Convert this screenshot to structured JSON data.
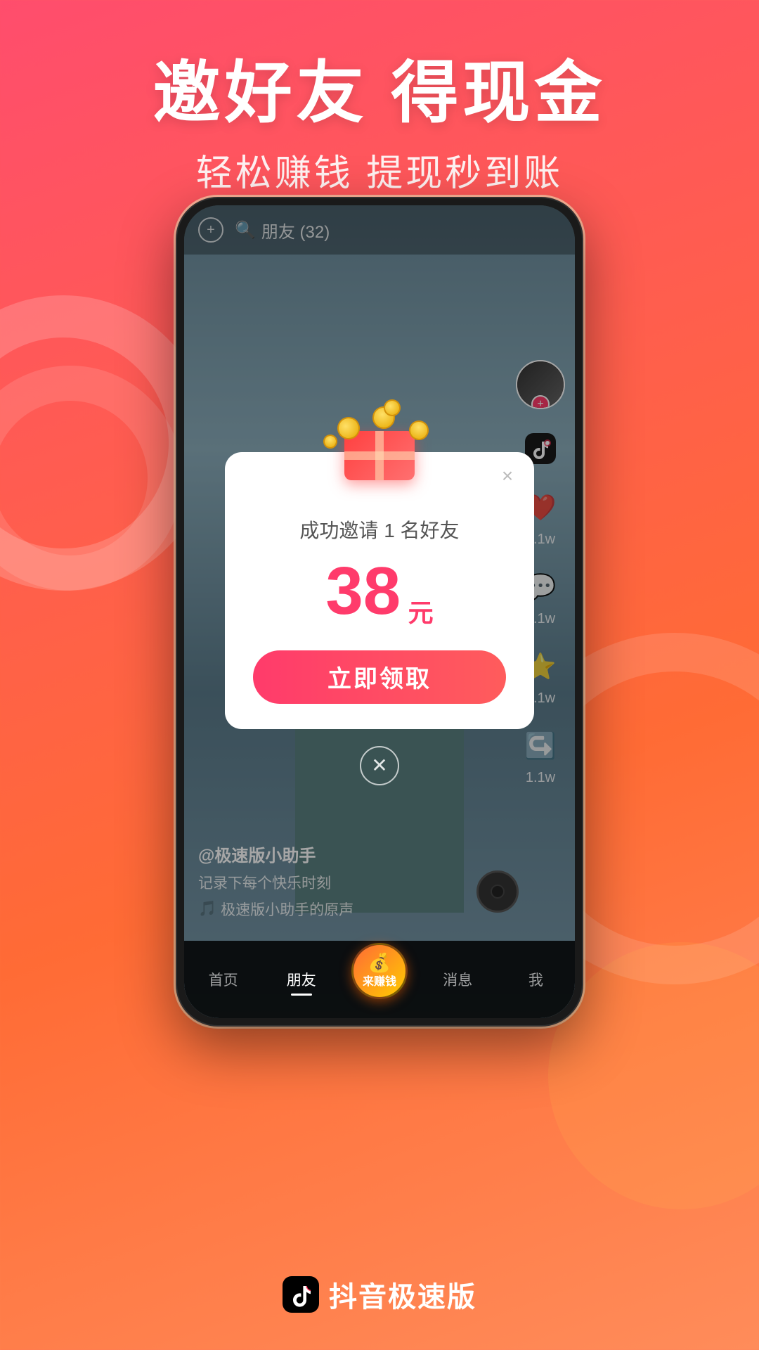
{
  "header": {
    "title": "邀好友 得现金",
    "subtitle": "轻松赚钱 提现秒到账"
  },
  "phone": {
    "top_bar": {
      "add_label": "+",
      "search_text": "朋友 (32)"
    },
    "modal": {
      "close_label": "×",
      "invite_text": "成功邀请 1 名好友",
      "amount": "38",
      "amount_unit": "元",
      "claim_button": "立即领取"
    },
    "sidebar": {
      "like_count": "1.1w",
      "comment_count": "1.1w",
      "favorite_count": "1.1w",
      "share_count": "1.1w"
    },
    "bottom_info": {
      "username": "@极速版小助手",
      "description": "记录下每个快乐时刻",
      "sound": "🎵 极速版小助手的原声"
    },
    "nav": {
      "home": "首页",
      "friends": "朋友",
      "center": "来赚钱",
      "messages": "消息",
      "me": "我"
    }
  },
  "branding": {
    "app_name": "抖音极速版"
  }
}
